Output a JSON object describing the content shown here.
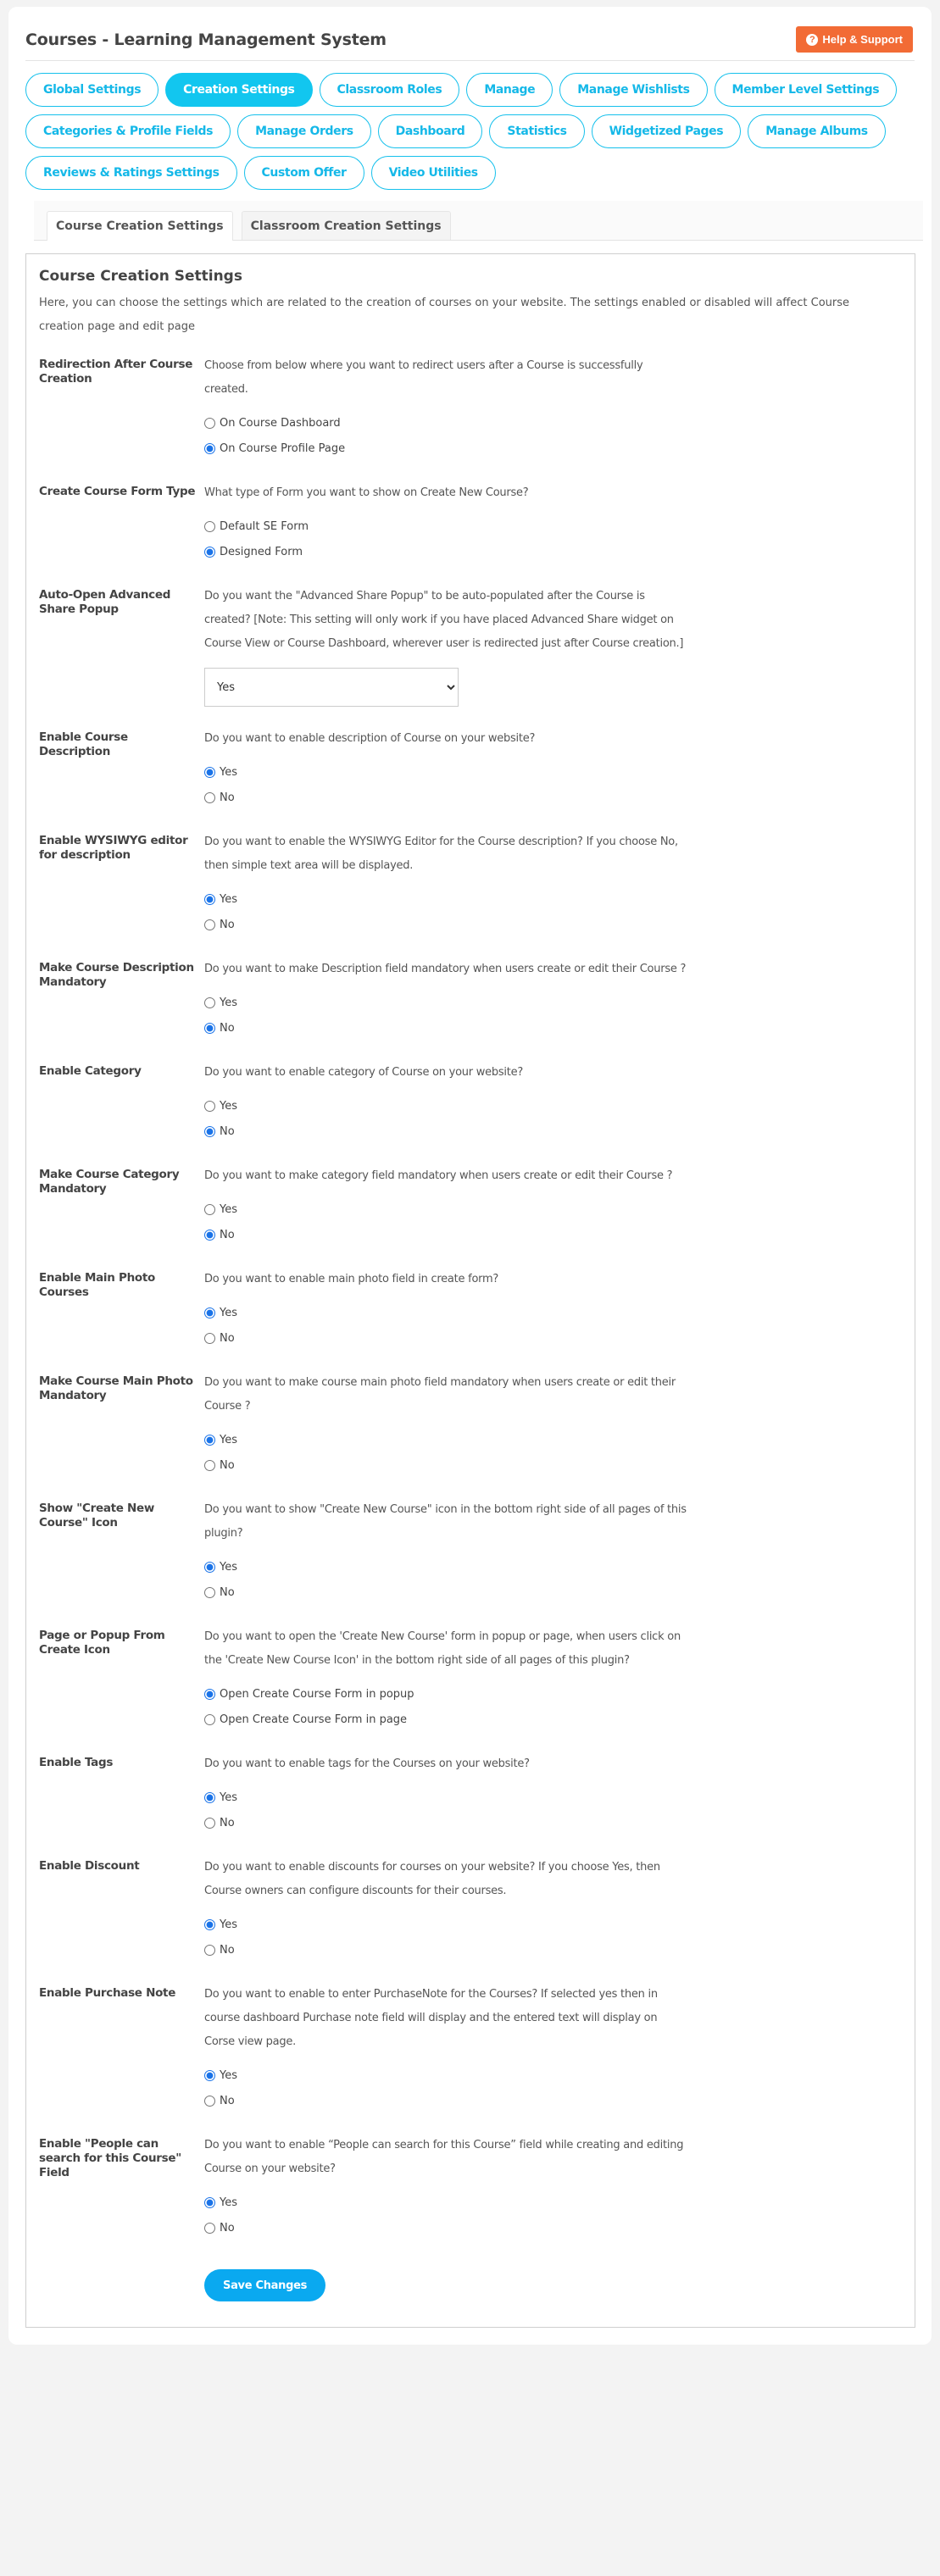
{
  "header": {
    "title": "Courses - Learning Management System",
    "help_label": "Help & Support",
    "help_icon": "question-circle-icon"
  },
  "nav": {
    "items": [
      {
        "label": "Global Settings",
        "active": false
      },
      {
        "label": "Creation Settings",
        "active": true
      },
      {
        "label": "Classroom Roles",
        "active": false
      },
      {
        "label": "Manage",
        "active": false
      },
      {
        "label": "Manage Wishlists",
        "active": false
      },
      {
        "label": "Member Level Settings",
        "active": false
      },
      {
        "label": "Categories & Profile Fields",
        "active": false
      },
      {
        "label": "Manage Orders",
        "active": false
      },
      {
        "label": "Dashboard",
        "active": false
      },
      {
        "label": "Statistics",
        "active": false
      },
      {
        "label": "Widgetized Pages",
        "active": false
      },
      {
        "label": "Manage Albums",
        "active": false
      },
      {
        "label": "Reviews & Ratings Settings",
        "active": false
      },
      {
        "label": "Custom Offer",
        "active": false
      },
      {
        "label": "Video Utilities",
        "active": false
      }
    ]
  },
  "tabs": [
    {
      "label": "Course Creation Settings",
      "active": true
    },
    {
      "label": "Classroom Creation Settings",
      "active": false
    }
  ],
  "panel": {
    "title": "Course Creation Settings",
    "intro": "Here, you can choose the settings which are related to the creation of courses on your website. The settings enabled or disabled will affect Course creation page and edit page",
    "save_label": "Save Changes"
  },
  "settings": [
    {
      "label": "Redirection After Course Creation",
      "description": "Choose from below where you want to redirect users after a Course is successfully created.",
      "type": "radio",
      "options": [
        "On Course Dashboard",
        "On Course Profile Page"
      ],
      "selected": 1
    },
    {
      "label": "Create Course Form Type",
      "description": "What type of Form you want to show on Create New Course?",
      "type": "radio",
      "options": [
        "Default SE Form",
        "Designed Form"
      ],
      "selected": 1
    },
    {
      "label": "Auto-Open Advanced Share Popup",
      "description": "Do you want the \"Advanced Share Popup\" to be auto-populated after the Course is created? [Note: This setting will only work if you have placed Advanced Share widget on Course View or Course Dashboard, wherever user is redirected just after Course creation.]",
      "type": "select",
      "value": "Yes"
    },
    {
      "label": "Enable Course Description",
      "description": "Do you want to enable description of Course on your website?",
      "type": "radio",
      "options": [
        "Yes",
        "No"
      ],
      "selected": 0
    },
    {
      "label": "Enable WYSIWYG editor for description",
      "description": "Do you want to enable the WYSIWYG Editor for the Course description? If you choose No, then simple text area will be displayed.",
      "type": "radio",
      "options": [
        "Yes",
        "No"
      ],
      "selected": 0
    },
    {
      "label": "Make Course Description Mandatory",
      "description": "Do you want to make Description field mandatory when users create or edit their Course ?",
      "type": "radio",
      "options": [
        "Yes",
        "No"
      ],
      "selected": 1
    },
    {
      "label": "Enable Category",
      "description": "Do you want to enable category of Course on your website?",
      "type": "radio",
      "options": [
        "Yes",
        "No"
      ],
      "selected": 1
    },
    {
      "label": "Make Course Category Mandatory",
      "description": "Do you want to make category field mandatory when users create or edit their Course ?",
      "type": "radio",
      "options": [
        "Yes",
        "No"
      ],
      "selected": 1
    },
    {
      "label": "Enable Main Photo Courses",
      "description": "Do you want to enable main photo field in create form?",
      "type": "radio",
      "options": [
        "Yes",
        "No"
      ],
      "selected": 0
    },
    {
      "label": "Make Course Main Photo Mandatory",
      "description": "Do you want to make course main photo field mandatory when users create or edit their Course ?",
      "type": "radio",
      "options": [
        "Yes",
        "No"
      ],
      "selected": 0
    },
    {
      "label": "Show \"Create New Course\" Icon",
      "description": "Do you want to show \"Create New Course\" icon in the bottom right side of all pages of this plugin?",
      "type": "radio",
      "options": [
        "Yes",
        "No"
      ],
      "selected": 0
    },
    {
      "label": "Page or Popup From Create Icon",
      "description": "Do you want to open the 'Create New Course' form in popup or page, when users click on the 'Create New Course Icon' in the bottom right side of all pages of this plugin?",
      "type": "radio",
      "options": [
        "Open Create Course Form in popup",
        "Open Create Course Form in page"
      ],
      "selected": 0
    },
    {
      "label": "Enable Tags",
      "description": "Do you want to enable tags for the Courses on your website?",
      "type": "radio",
      "options": [
        "Yes",
        "No"
      ],
      "selected": 0
    },
    {
      "label": "Enable Discount",
      "description": "Do you want to enable discounts for courses on your website? If you choose Yes, then Course owners can configure discounts for their courses.",
      "type": "radio",
      "options": [
        "Yes",
        "No"
      ],
      "selected": 0
    },
    {
      "label": "Enable Purchase Note",
      "description": "Do you want to enable to enter PurchaseNote for the Courses? If selected yes then in course dashboard Purchase note field will display and the entered text will display on Corse view page.",
      "type": "radio",
      "options": [
        "Yes",
        "No"
      ],
      "selected": 0
    },
    {
      "label": "Enable \"People can search for this Course\" Field",
      "description": "Do you want to enable “People can search for this Course” field while creating and editing Course on your website?",
      "type": "radio",
      "options": [
        "Yes",
        "No"
      ],
      "selected": 0
    }
  ],
  "colors": {
    "accent": "#12c6ef",
    "help_button": "#f26b35",
    "save_button": "#0aa9f0"
  }
}
